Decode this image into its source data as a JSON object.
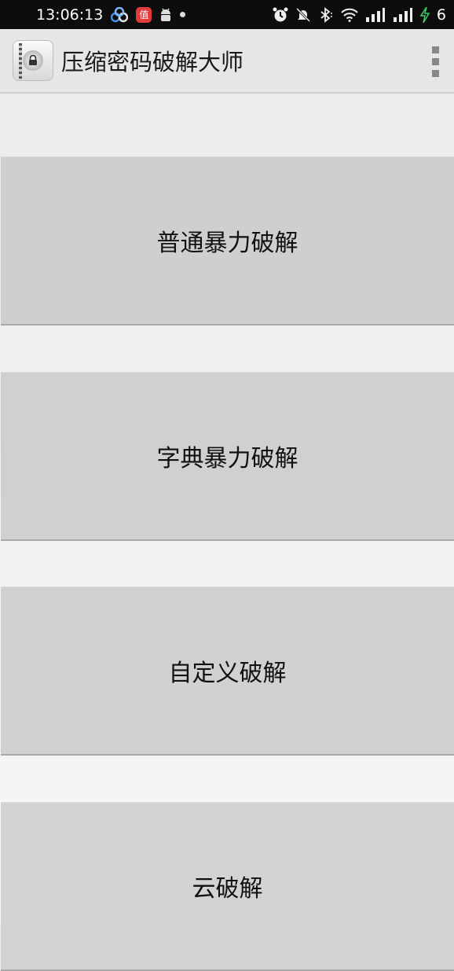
{
  "status_bar": {
    "time": "13:06:13",
    "badge_text": "值",
    "battery_level": "6",
    "icons": [
      "cloud-sync-icon",
      "app-badge-icon",
      "android-icon",
      "dot-icon",
      "alarm-icon",
      "mute-icon",
      "bluetooth-icon",
      "wifi-icon",
      "signal-icon",
      "signal-icon-2",
      "charging-icon"
    ]
  },
  "app_bar": {
    "title": "压缩密码破解大师",
    "icon": "zip-lock-icon",
    "menu_icon": "overflow-menu-icon"
  },
  "buttons": [
    {
      "label": "普通暴力破解"
    },
    {
      "label": "字典暴力破解"
    },
    {
      "label": "自定义破解"
    },
    {
      "label": "云破解"
    }
  ]
}
